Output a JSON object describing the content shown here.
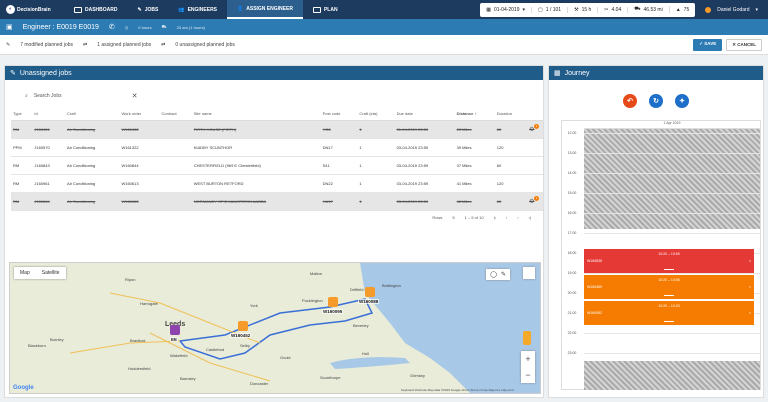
{
  "app": {
    "logo_text": "DecisionBrain"
  },
  "nav": [
    {
      "label": "DASHBOARD"
    },
    {
      "label": "JOBS"
    },
    {
      "label": "ENGINEERS"
    },
    {
      "label": "ASSIGN ENGINEER"
    },
    {
      "label": "PLAN"
    }
  ],
  "stats": {
    "date": "01-04-2019",
    "count": "1 / 101",
    "hours": "15 h",
    "ratio": "4.04",
    "miles": "46.53 mi",
    "score": "75"
  },
  "user": {
    "name": "Daniel Godard"
  },
  "subbar": {
    "engineer": "Engineer : E0019 E0019",
    "work_hours": "0 hours",
    "drive_hours": "23 am (1 hours)"
  },
  "summary": {
    "modified": "7 modified planned jobs",
    "assigned": "1 assigned planned jobs",
    "unassigned": "0 unassigned planned jobs",
    "save": "SAVE",
    "cancel": "CANCEL"
  },
  "unassigned": {
    "title": "Unassigned jobs",
    "search_placeholder": "Search Jobs",
    "columns": [
      "Type",
      "Id",
      "Craft",
      "Work order",
      "Contract",
      "Site name",
      "Post code",
      "Craft (eta)",
      "Due date",
      "Distance",
      "Duration"
    ],
    "rows": [
      {
        "type": "RM",
        "id": "J160451",
        "craft": "Air Conditioning",
        "wo": "W160452",
        "contract": "",
        "site": "FIRTH HOUSE (FIRTH)",
        "post": "YO8",
        "eta": "1",
        "due": "01-04-2019 23:59",
        "dist": "23 Miles",
        "dur": "60",
        "struck": true,
        "badge": "1"
      },
      {
        "type": "PPM",
        "id": "J160570",
        "craft": "Air Conditioning",
        "wo": "W161322",
        "contract": "",
        "site": "KIADBY SCUNTHOR",
        "post": "DN17",
        "eta": "1",
        "due": "03-04-2019 23:59",
        "dist": "39 Miles",
        "dur": "120",
        "struck": false,
        "badge": ""
      },
      {
        "type": "RM",
        "id": "J160843",
        "craft": "Air Conditioning",
        "wo": "W160844",
        "contract": "",
        "site": "CHESTERFIELD (969 E Chesterfield)",
        "post": "S41",
        "eta": "1",
        "due": "03-04-2019 23:59",
        "dist": "37 Miles",
        "dur": "60",
        "struck": false,
        "badge": ""
      },
      {
        "type": "RM",
        "id": "J160961",
        "craft": "Air Conditioning",
        "wo": "W160613",
        "contract": "",
        "site": "WEST BURTON RETFORD",
        "post": "DN22",
        "eta": "1",
        "due": "03-04-2019 23:59",
        "dist": "41 Miles",
        "dur": "120",
        "struck": false,
        "badge": ""
      },
      {
        "type": "RM",
        "id": "J160664",
        "craft": "Air Conditioning",
        "wo": "W160665",
        "contract": "",
        "site": "NORMANDY SPIS MAUSTERIN AABBA",
        "post": "HU17",
        "eta": "1",
        "due": "03-04-2019 23:59",
        "dist": "46 Miles",
        "dur": "60",
        "struck": true,
        "badge": "1"
      }
    ],
    "pagination": {
      "rows_label": "Rows",
      "rows_value": "5",
      "range": "1 – 5 of 10"
    }
  },
  "map": {
    "tab_map": "Map",
    "tab_sat": "Satellite",
    "google": "Google",
    "copyright": "Keyboard shortcuts   Map data ©2019 Google   10 km   Terms of Use   Report a map error",
    "places": [
      "Ripon",
      "Harrogate",
      "Leeds",
      "Bradford",
      "Wakefield",
      "Huddersfield",
      "Barnsley",
      "Doncaster",
      "Selby",
      "York",
      "Blackburn",
      "Burnley",
      "Goole",
      "Scunthorpe",
      "Hull",
      "Bridlington",
      "Pocklington",
      "Beverley",
      "Driffield",
      "Castleford",
      "Grimsby",
      "Malton"
    ],
    "markers": [
      "W160088",
      "W160095",
      "W160452",
      "EE"
    ]
  },
  "journey": {
    "title": "Journey",
    "day": "1 Apr 2019",
    "times": [
      "12:00",
      "13:00",
      "14:00",
      "15:00",
      "16:00",
      "17:00",
      "18:00",
      "19:00",
      "20:00",
      "21:00",
      "22:00",
      "23:00"
    ],
    "events": [
      {
        "label": "W160835",
        "time": "10:20 – 10:59",
        "color": "#e53935"
      },
      {
        "label": "W160459",
        "time": "10:20 – 10:55",
        "color": "#f57c00"
      },
      {
        "label": "W160452",
        "time": "10:20 – 10:20",
        "color": "#f57c00"
      }
    ]
  },
  "colors": {
    "topnav": "#1d3a5f",
    "subbar": "#2d7bb3",
    "panel": "#1f5c8a",
    "orange": "#f57c00",
    "red": "#e53935"
  }
}
